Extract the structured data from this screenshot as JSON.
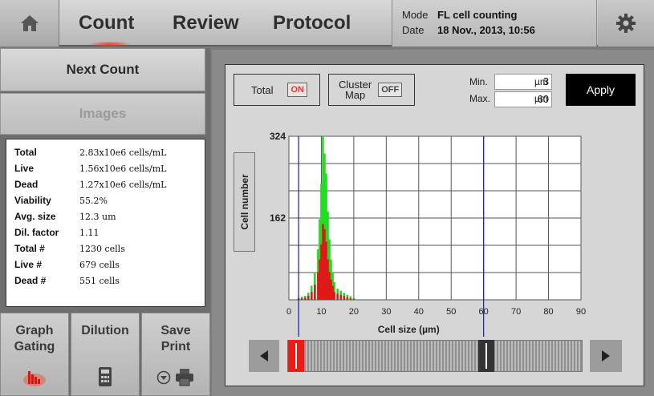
{
  "header": {
    "tabs": [
      {
        "label": "Count"
      },
      {
        "label": "Review"
      },
      {
        "label": "Protocol"
      }
    ],
    "mode_label": "Mode",
    "mode_value": "FL cell counting",
    "date_label": "Date",
    "date_value": "18 Nov., 2013, 10:56"
  },
  "left": {
    "next_count": "Next Count",
    "images": "Images",
    "results": [
      {
        "k": "Total",
        "v": "2.83x10e6 cells/mL"
      },
      {
        "k": "Live",
        "v": "1.56x10e6 cells/mL"
      },
      {
        "k": "Dead",
        "v": "1.27x10e6 cells/mL"
      },
      {
        "k": "Viability",
        "v": "55.2%"
      },
      {
        "k": "Avg. size",
        "v": "12.3 um"
      },
      {
        "k": "Dil. factor",
        "v": "1.11"
      },
      {
        "k": "Total #",
        "v": "1230 cells"
      },
      {
        "k": "Live #",
        "v": "679 cells"
      },
      {
        "k": "Dead #",
        "v": "551 cells"
      }
    ],
    "buttons": {
      "graph_line1": "Graph",
      "graph_line2": "Gating",
      "dilution": "Dilution",
      "save_line1": "Save",
      "save_line2": "Print"
    }
  },
  "controls": {
    "total_label": "Total",
    "total_state": "ON",
    "cluster_label_1": "Cluster",
    "cluster_label_2": "Map",
    "cluster_state": "OFF",
    "min_label": "Min.",
    "min_value": "3",
    "max_label": "Max.",
    "max_value": "60",
    "unit": "µm",
    "apply": "Apply"
  },
  "colors": {
    "live": "#22dd22",
    "dead": "#e01818",
    "gate_line": "#1a1aa8",
    "slider_min": "#ee1a14"
  },
  "chart_data": {
    "type": "bar",
    "ylabel": "Cell number",
    "xlabel": "Cell size (µm)",
    "xlim": [
      0,
      90
    ],
    "ylim": [
      0,
      324
    ],
    "x_ticks": [
      0,
      10,
      20,
      30,
      40,
      50,
      60,
      70,
      80,
      90
    ],
    "y_ticks": [
      162,
      324
    ],
    "grid": true,
    "gate": [
      3,
      60
    ],
    "x": [
      3,
      4,
      5,
      6,
      7,
      8,
      9,
      9.5,
      10,
      10.5,
      11,
      11.5,
      12,
      12.5,
      13,
      13.5,
      14,
      15,
      16,
      17,
      18,
      19,
      20
    ],
    "series": [
      {
        "values": [
          4,
          6,
          8,
          14,
          28,
          55,
          100,
          160,
          230,
          324,
          290,
          250,
          175,
          120,
          80,
          55,
          35,
          22,
          18,
          14,
          10,
          7,
          4
        ]
      },
      {
        "values": [
          2,
          3,
          4,
          8,
          16,
          30,
          55,
          80,
          110,
          150,
          140,
          115,
          80,
          55,
          40,
          28,
          16,
          12,
          10,
          8,
          5,
          3,
          2
        ]
      }
    ]
  }
}
